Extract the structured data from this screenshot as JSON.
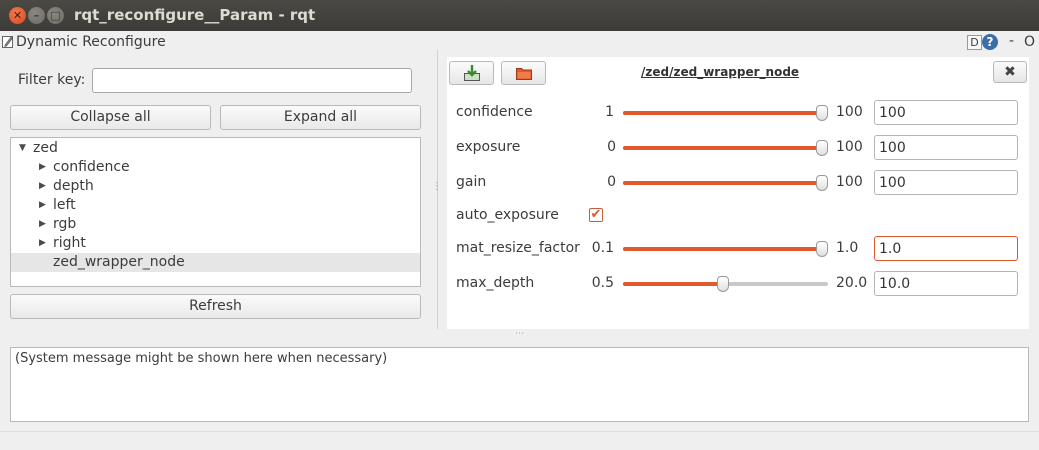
{
  "window": {
    "title": "rqt_reconfigure__Param - rqt",
    "close_glyph": "✕",
    "min_glyph": "–",
    "max_glyph": "□"
  },
  "plugin": {
    "title": "Dynamic Reconfigure",
    "icon": "edit-icon",
    "help_d": "D",
    "help_q": "?",
    "minus": "-",
    "o": "O"
  },
  "filter": {
    "label": "Filter key:",
    "value": "",
    "placeholder": ""
  },
  "buttons": {
    "collapse_all": "Collapse all",
    "expand_all": "Expand all",
    "refresh": "Refresh"
  },
  "tree": {
    "root": {
      "label": "zed",
      "expanded": true
    },
    "children": [
      {
        "label": "confidence",
        "expandable": true
      },
      {
        "label": "depth",
        "expandable": true
      },
      {
        "label": "left",
        "expandable": true
      },
      {
        "label": "rgb",
        "expandable": true
      },
      {
        "label": "right",
        "expandable": true
      },
      {
        "label": "zed_wrapper_node",
        "expandable": false,
        "selected": true
      }
    ]
  },
  "node_panel": {
    "title": "/zed/zed_wrapper_node",
    "close_glyph": "✖",
    "params": [
      {
        "name": "confidence",
        "min": "1",
        "max": "100",
        "value": "100",
        "fraction": 1.0
      },
      {
        "name": "exposure",
        "min": "0",
        "max": "100",
        "value": "100",
        "fraction": 1.0
      },
      {
        "name": "gain",
        "min": "0",
        "max": "100",
        "value": "100",
        "fraction": 1.0
      },
      {
        "name": "auto_exposure",
        "checked": true,
        "check_glyph": "✔"
      },
      {
        "name": "mat_resize_factor",
        "min": "0.1",
        "max": "1.0",
        "value": "1.0",
        "fraction": 1.0
      },
      {
        "name": "max_depth",
        "min": "0.5",
        "max": "20.0",
        "value": "10.0",
        "fraction": 0.487
      }
    ]
  },
  "messages": {
    "text": "(System message might be shown here when necessary)"
  },
  "colors": {
    "accent": "#e2582d",
    "titlebar": "#3c3b37"
  }
}
